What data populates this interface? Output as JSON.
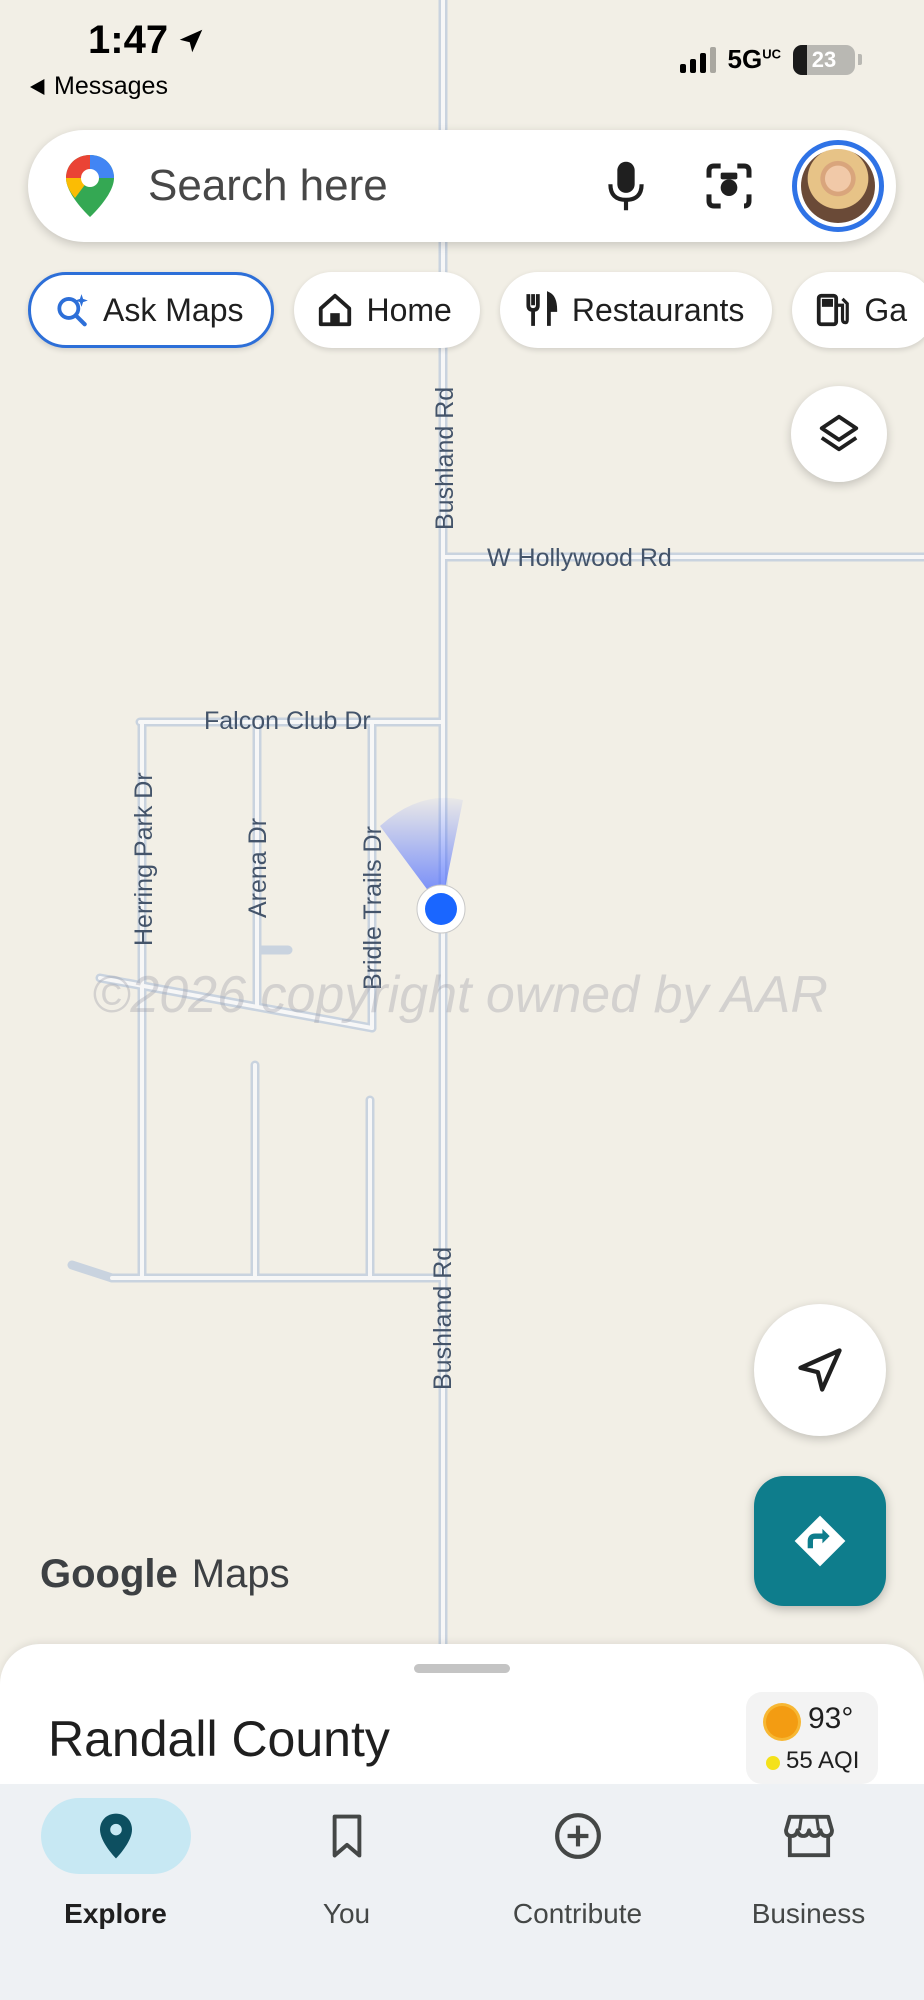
{
  "status_bar": {
    "time": "1:47",
    "back_label": "Messages",
    "network": "5G",
    "network_suffix": "UC",
    "battery": "23",
    "battery_level_pct": 23
  },
  "search": {
    "placeholder": "Search here"
  },
  "chips": [
    {
      "label": "Ask Maps",
      "icon": "ask-maps-icon",
      "active": true
    },
    {
      "label": "Home",
      "icon": "home-icon"
    },
    {
      "label": "Restaurants",
      "icon": "restaurant-icon"
    },
    {
      "label": "Ga",
      "icon": "gas-station-icon"
    }
  ],
  "map": {
    "roads": [
      "Bushland Rd",
      "W Hollywood Rd",
      "Falcon Club Dr",
      "Herring Park Dr",
      "Arena Dr",
      "Bridle Trails Dr",
      "Bushland Rd"
    ],
    "watermark": "©2026 copyright owned by AAR",
    "brand_google": "Google",
    "brand_maps": "Maps"
  },
  "sheet": {
    "title": "Randall County",
    "temperature": "93°",
    "aqi": "55 AQI"
  },
  "nav": [
    {
      "label": "Explore",
      "icon": "explore-pin-icon",
      "active": true
    },
    {
      "label": "You",
      "icon": "bookmark-icon"
    },
    {
      "label": "Contribute",
      "icon": "add-circle-icon"
    },
    {
      "label": "Business",
      "icon": "storefront-icon"
    }
  ],
  "colors": {
    "accent": "#2f73e6",
    "directions": "#0e7d8c",
    "location_dot": "#1a66ff",
    "map_bg": "#f2efe6",
    "road": "#c9d3df"
  }
}
